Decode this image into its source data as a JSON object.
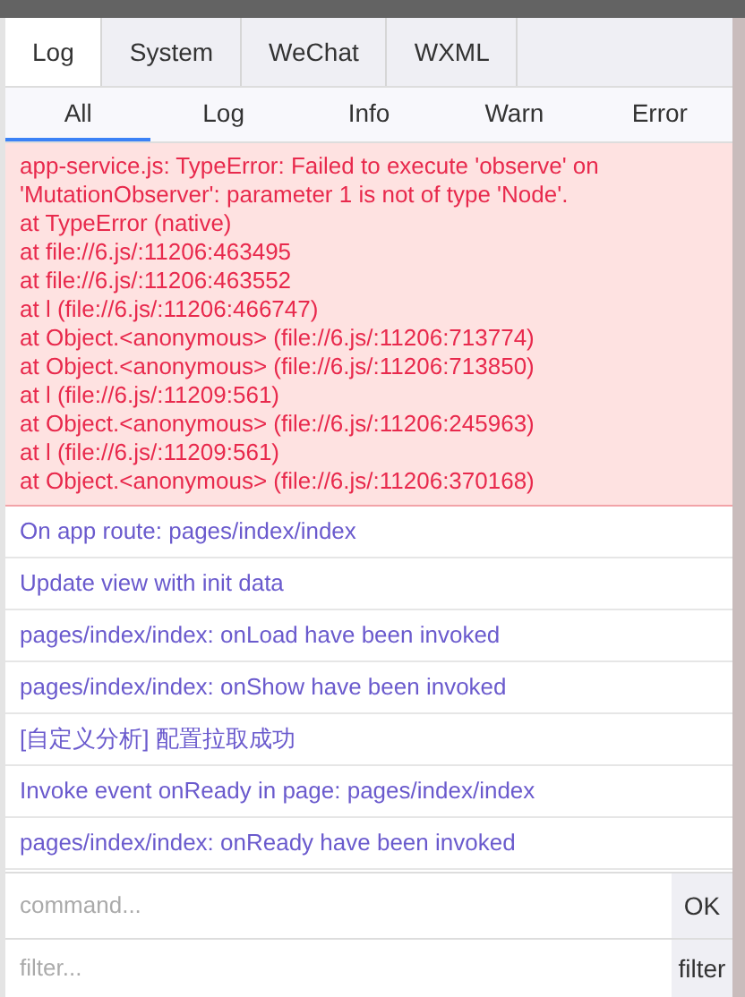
{
  "tabs": [
    {
      "label": "Log",
      "selected": true
    },
    {
      "label": "System",
      "selected": false
    },
    {
      "label": "WeChat",
      "selected": false
    },
    {
      "label": "WXML",
      "selected": false
    }
  ],
  "levels": [
    {
      "label": "All",
      "selected": true
    },
    {
      "label": "Log",
      "selected": false
    },
    {
      "label": "Info",
      "selected": false
    },
    {
      "label": "Warn",
      "selected": false
    },
    {
      "label": "Error",
      "selected": false
    }
  ],
  "entries": [
    {
      "kind": "error",
      "lines": [
        "app-service.js: TypeError: Failed to execute 'observe' on 'MutationObserver': parameter 1 is not of type 'Node'.",
        "at TypeError (native)",
        "at file://6.js/:11206:463495",
        "at file://6.js/:11206:463552",
        "at l (file://6.js/:11206:466747)",
        "at Object.<anonymous> (file://6.js/:11206:713774)",
        "at Object.<anonymous> (file://6.js/:11206:713850)",
        "at l (file://6.js/:11209:561)",
        "at Object.<anonymous> (file://6.js/:11206:245963)",
        "at l (file://6.js/:11209:561)",
        "at Object.<anonymous> (file://6.js/:11206:370168)"
      ]
    },
    {
      "kind": "log",
      "lines": [
        "On app route: pages/index/index"
      ]
    },
    {
      "kind": "log",
      "lines": [
        "Update view with init data"
      ]
    },
    {
      "kind": "log",
      "lines": [
        "pages/index/index: onLoad have been invoked"
      ]
    },
    {
      "kind": "log",
      "lines": [
        "pages/index/index: onShow have been invoked"
      ]
    },
    {
      "kind": "log",
      "lines": [
        "[自定义分析] 配置拉取成功"
      ]
    },
    {
      "kind": "log",
      "lines": [
        "Invoke event onReady in page: pages/index/index"
      ]
    },
    {
      "kind": "log",
      "lines": [
        "pages/index/index: onReady have been invoked"
      ]
    }
  ],
  "command": {
    "placeholder": "command...",
    "button": "OK"
  },
  "filter": {
    "placeholder": "filter...",
    "button": "filter"
  }
}
